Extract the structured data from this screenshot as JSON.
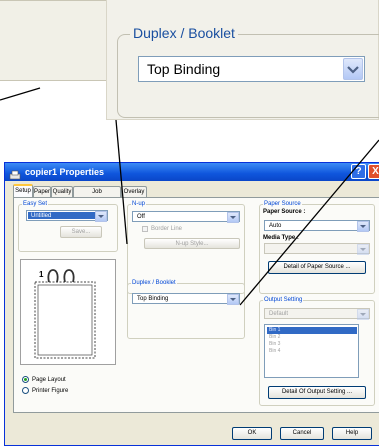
{
  "callout": {
    "legend": "Duplex / Booklet",
    "selected": "Top Binding"
  },
  "window": {
    "title": "copier1 Properties",
    "help_glyph": "?",
    "close_glyph": "X",
    "tabs": [
      "Setup",
      "Paper",
      "Quality",
      "Job Management",
      "Overlay"
    ]
  },
  "easy_set": {
    "legend": "Easy Set",
    "value": "Untitled",
    "save_label": "Save..."
  },
  "nup": {
    "legend": "N-up",
    "value": "Off",
    "border_line_label": "Border Line",
    "style_button": "N-up Style..."
  },
  "duplex": {
    "legend": "Duplex / Booklet",
    "value": "Top Binding"
  },
  "paper_source": {
    "legend": "Paper Source",
    "source_label": "Paper Source :",
    "source_value": "Auto",
    "media_label": "Media Type :",
    "detail_button": "Detail of Paper Source ..."
  },
  "output_setting": {
    "legend": "Output Setting",
    "value": "Default",
    "bins": [
      "Bin 1",
      "Bin 2",
      "Bin 3",
      "Bin 4"
    ],
    "detail_button": "Detail Of Output Setting ..."
  },
  "preview": {
    "page_number": "1"
  },
  "view_mode": {
    "page_layout": "Page Layout",
    "printer_figure": "Printer Figure"
  },
  "footer": {
    "ok": "OK",
    "cancel": "Cancel",
    "help": "Help"
  }
}
